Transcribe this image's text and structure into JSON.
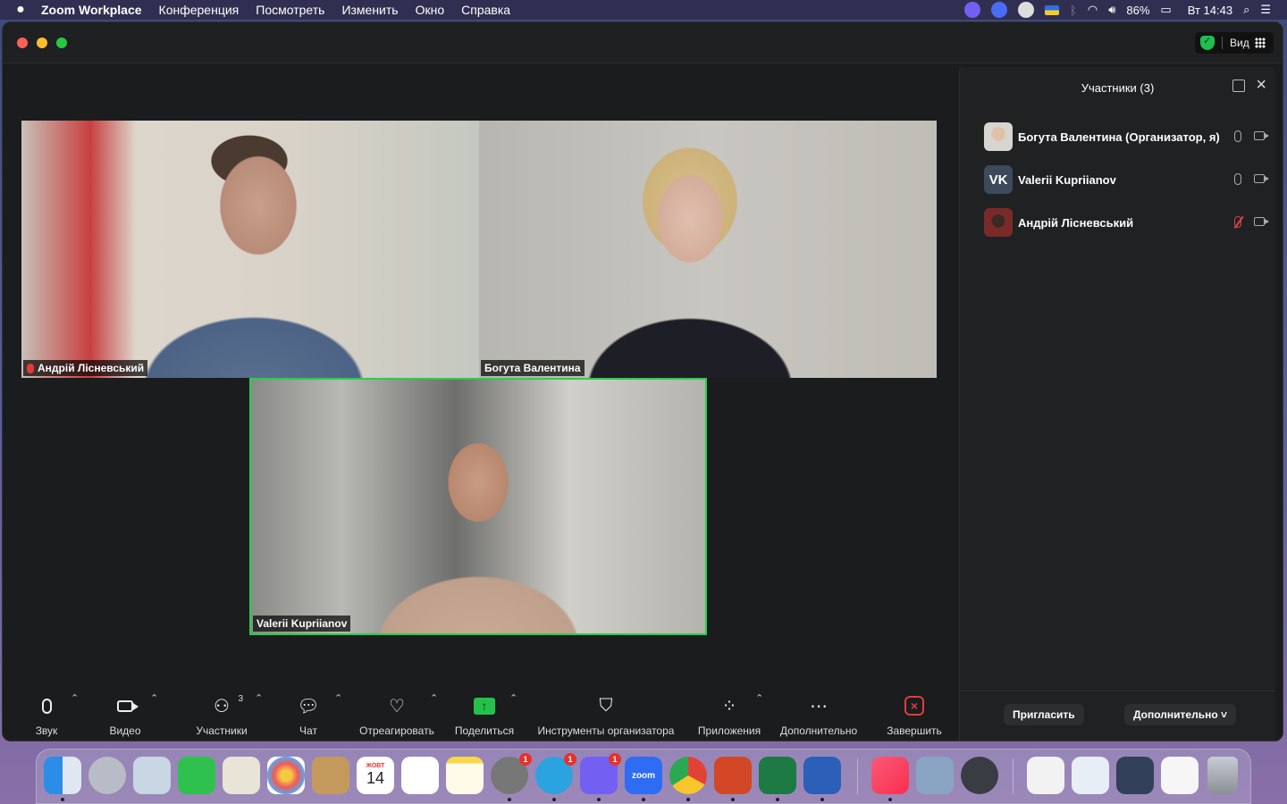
{
  "menubar": {
    "apple": "",
    "app": "Zoom Workplace",
    "items": [
      "Конференция",
      "Посмотреть",
      "Изменить",
      "Окно",
      "Справка"
    ],
    "battery": "86%",
    "clock": "Вт 14:43"
  },
  "window": {
    "view_label": "Вид"
  },
  "tiles": [
    {
      "name": "Андрій Лісневський",
      "muted": true
    },
    {
      "name": "Богута Валентина",
      "muted": false
    },
    {
      "name": "Valerii Kupriianov",
      "muted": false,
      "active_speaker": true
    }
  ],
  "panel": {
    "title": "Участники (3)",
    "participants": [
      {
        "name": "Богута Валентина (Организатор, я)",
        "initials": "",
        "mic_muted": false
      },
      {
        "name": "Valerii Kupriianov",
        "initials": "VK",
        "mic_muted": false
      },
      {
        "name": "Андрій Лісневський",
        "initials": "",
        "mic_muted": true
      }
    ],
    "invite_label": "Пригласить",
    "more_label": "Дополнительно ˅"
  },
  "toolbar": {
    "audio": "Звук",
    "video": "Видео",
    "participants": "Участники",
    "participants_count": "3",
    "chat": "Чат",
    "react": "Отреагировать",
    "share": "Поделиться",
    "host_tools": "Инструменты организатора",
    "apps": "Приложения",
    "more": "Дополнительно",
    "end": "Завершить"
  },
  "dock": {
    "calendar_month": "ЖОВТ",
    "calendar_day": "14",
    "zoom_label": "zoom",
    "badges": {
      "system_prefs": "1",
      "telegram": "1",
      "viber": "1"
    }
  },
  "colors": {
    "active_speaker": "#25d146",
    "share": "#23c14a",
    "end": "#e03c3c",
    "muted": "#e04545"
  }
}
